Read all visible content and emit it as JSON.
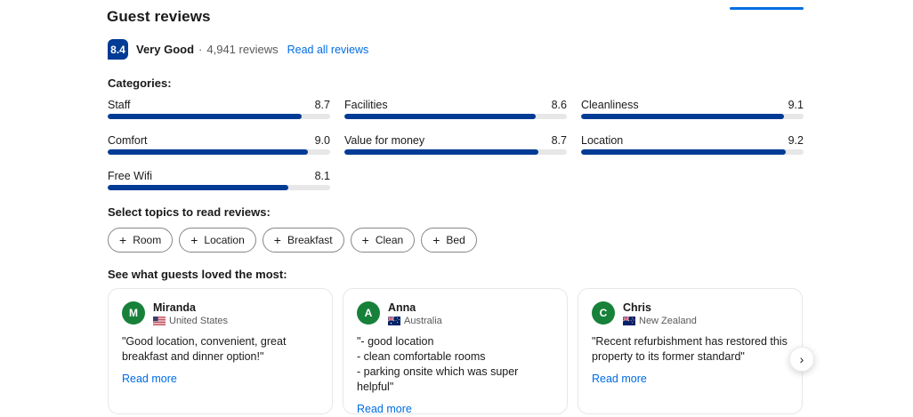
{
  "header": {
    "title": "Guest reviews",
    "tab_indicator_color": "#006ce4"
  },
  "rating": {
    "score": "8.4",
    "label": "Very Good",
    "separator": "·",
    "reviews_count": "4,941 reviews",
    "read_all_link": "Read all reviews",
    "badge_color": "#003b95"
  },
  "categories": {
    "heading": "Categories:",
    "bar_fill_color": "#003b95",
    "bar_track_color": "#e7e7e7",
    "items": [
      {
        "label": "Staff",
        "score": "8.7"
      },
      {
        "label": "Facilities",
        "score": "8.6"
      },
      {
        "label": "Cleanliness",
        "score": "9.1"
      },
      {
        "label": "Comfort",
        "score": "9.0"
      },
      {
        "label": "Value for money",
        "score": "8.7"
      },
      {
        "label": "Location",
        "score": "9.2"
      },
      {
        "label": "Free Wifi",
        "score": "8.1"
      }
    ]
  },
  "topics": {
    "heading": "Select topics to read reviews:",
    "plus_icon": "+",
    "items": [
      "Room",
      "Location",
      "Breakfast",
      "Clean",
      "Bed"
    ]
  },
  "loved": {
    "heading": "See what guests loved the most:",
    "avatar_color": "#17813a",
    "link_color": "#006ce4",
    "next_button_icon": "›",
    "cards": [
      {
        "initial": "M",
        "name": "Miranda",
        "country": "United States",
        "quote": "\"Good location, convenient, great breakfast and dinner option!\"",
        "read_more": "Read more"
      },
      {
        "initial": "A",
        "name": "Anna",
        "country": "Australia",
        "quote": "\"- good location\n- clean comfortable rooms\n- parking onsite which was super helpful\"",
        "read_more": "Read more"
      },
      {
        "initial": "C",
        "name": "Chris",
        "country": "New Zealand",
        "quote": "\"Recent refurbishment has restored this property to its former standard\"",
        "read_more": "Read more"
      }
    ]
  }
}
